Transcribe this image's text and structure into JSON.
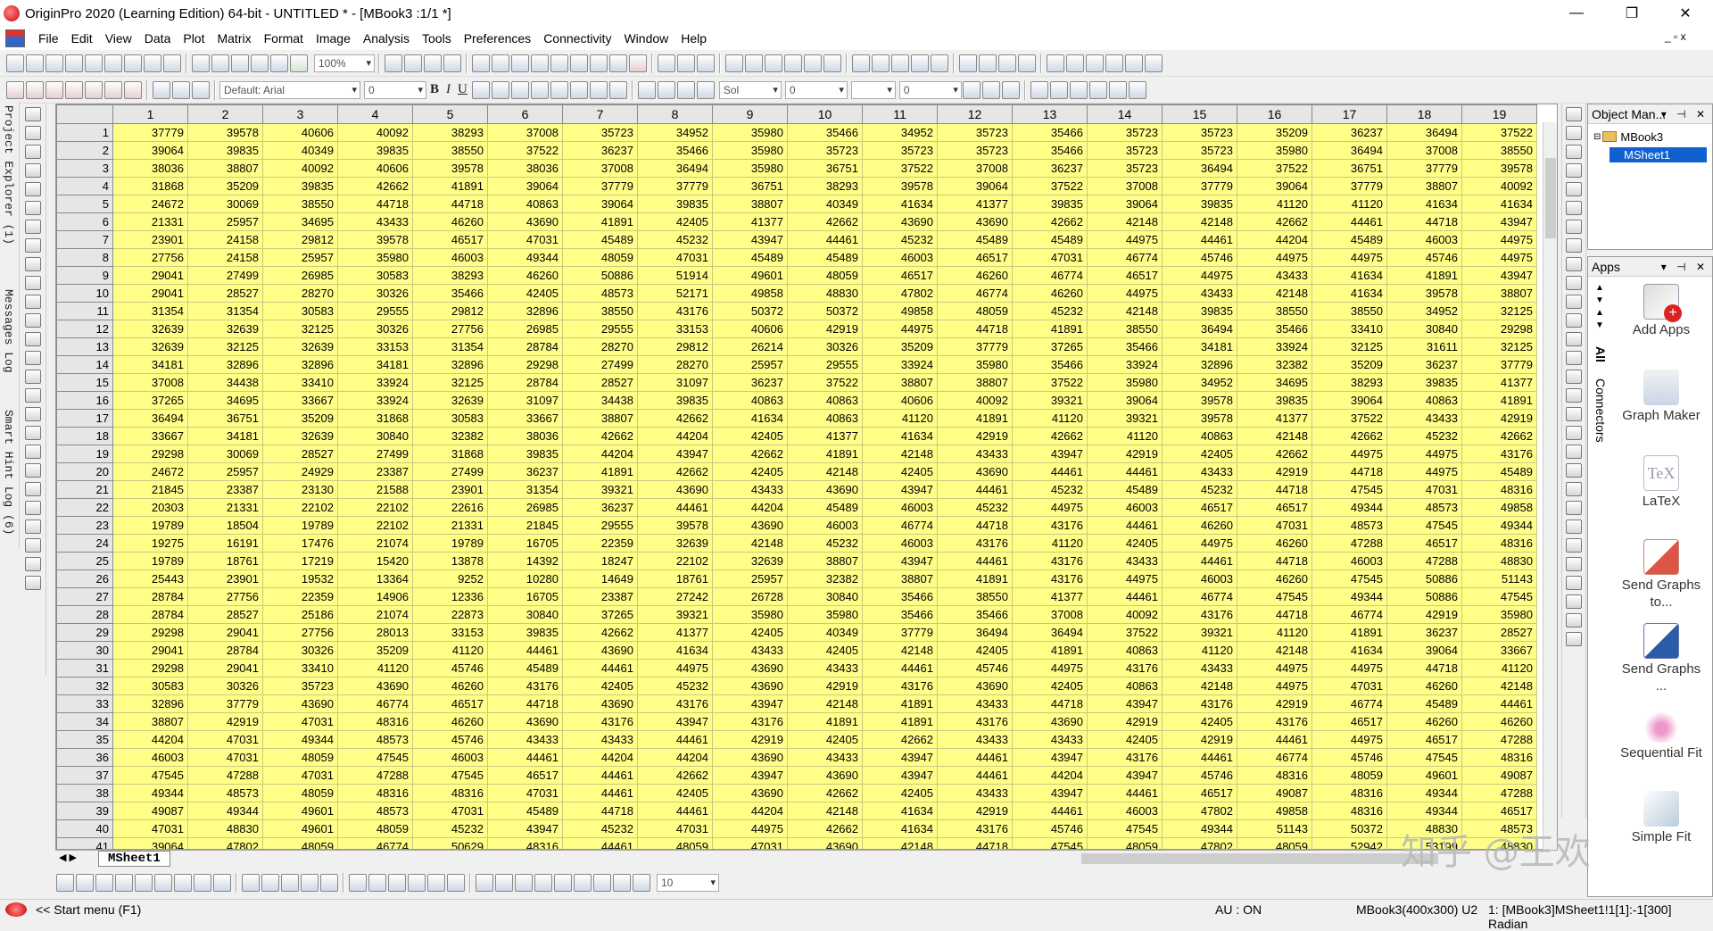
{
  "window": {
    "title": "OriginPro 2020 (Learning Edition) 64-bit - UNTITLED * - [MBook3 :1/1  *]",
    "minimize": "—",
    "maximize": "❐",
    "close": "✕",
    "mdi_controls": "_ ▫ x"
  },
  "menu": [
    "File",
    "Edit",
    "View",
    "Data",
    "Plot",
    "Matrix",
    "Format",
    "Image",
    "Analysis",
    "Tools",
    "Preferences",
    "Connectivity",
    "Window",
    "Help"
  ],
  "toolbar": {
    "zoom": "100%",
    "font": "Default: Arial",
    "font_size": "0",
    "line_style": "Sol",
    "line_width": "0",
    "size2": "0",
    "bottom_size": "10"
  },
  "left_tabs": {
    "project_explorer": "Project Explorer (1)",
    "messages_log": "Messages Log",
    "smart_hint_log": "Smart Hint Log (6)"
  },
  "sheet": {
    "tab_label": "MSheet1",
    "columns": [
      "1",
      "2",
      "3",
      "4",
      "5",
      "6",
      "7",
      "8",
      "9",
      "10",
      "11",
      "12",
      "13",
      "14",
      "15",
      "16",
      "17",
      "18",
      "19"
    ],
    "rows": [
      [
        "1",
        [
          "37779",
          "39578",
          "40606",
          "40092",
          "38293",
          "37008",
          "35723",
          "34952",
          "35980",
          "35466",
          "34952",
          "35723",
          "35466",
          "35723",
          "35723",
          "35209",
          "36237",
          "36494",
          "37522"
        ]
      ],
      [
        "2",
        [
          "39064",
          "39835",
          "40349",
          "39835",
          "38550",
          "37522",
          "36237",
          "35466",
          "35980",
          "35723",
          "35723",
          "35723",
          "35466",
          "35723",
          "35723",
          "35980",
          "36494",
          "37008",
          "38550"
        ]
      ],
      [
        "3",
        [
          "38036",
          "38807",
          "40092",
          "40606",
          "39578",
          "38036",
          "37008",
          "36494",
          "35980",
          "36751",
          "37522",
          "37008",
          "36237",
          "35723",
          "36494",
          "37522",
          "36751",
          "37779",
          "39578"
        ]
      ],
      [
        "4",
        [
          "31868",
          "35209",
          "39835",
          "42662",
          "41891",
          "39064",
          "37779",
          "37779",
          "36751",
          "38293",
          "39578",
          "39064",
          "37522",
          "37008",
          "37779",
          "39064",
          "37779",
          "38807",
          "40092"
        ]
      ],
      [
        "5",
        [
          "24672",
          "30069",
          "38550",
          "44718",
          "44718",
          "40863",
          "39064",
          "39835",
          "38807",
          "40349",
          "41634",
          "41377",
          "39835",
          "39064",
          "39835",
          "41120",
          "41120",
          "41634",
          "41634"
        ]
      ],
      [
        "6",
        [
          "21331",
          "25957",
          "34695",
          "43433",
          "46260",
          "43690",
          "41891",
          "42405",
          "41377",
          "42662",
          "43690",
          "43690",
          "42662",
          "42148",
          "42148",
          "42662",
          "44461",
          "44718",
          "43947"
        ]
      ],
      [
        "7",
        [
          "23901",
          "24158",
          "29812",
          "39578",
          "46517",
          "47031",
          "45489",
          "45232",
          "43947",
          "44461",
          "45232",
          "45489",
          "45489",
          "44975",
          "44461",
          "44204",
          "45489",
          "46003",
          "44975"
        ]
      ],
      [
        "8",
        [
          "27756",
          "24158",
          "25957",
          "35980",
          "46003",
          "49344",
          "48059",
          "47031",
          "45489",
          "45489",
          "46003",
          "46517",
          "47031",
          "46774",
          "45746",
          "44975",
          "44975",
          "45746",
          "44975"
        ]
      ],
      [
        "9",
        [
          "29041",
          "27499",
          "26985",
          "30583",
          "38293",
          "46260",
          "50886",
          "51914",
          "49601",
          "48059",
          "46517",
          "46260",
          "46774",
          "46517",
          "44975",
          "43433",
          "41634",
          "41891",
          "43947"
        ]
      ],
      [
        "10",
        [
          "29041",
          "28527",
          "28270",
          "30326",
          "35466",
          "42405",
          "48573",
          "52171",
          "49858",
          "48830",
          "47802",
          "46774",
          "46260",
          "44975",
          "43433",
          "42148",
          "41634",
          "39578",
          "38807"
        ]
      ],
      [
        "11",
        [
          "31354",
          "31354",
          "30583",
          "29555",
          "29812",
          "32896",
          "38550",
          "43176",
          "50372",
          "50372",
          "49858",
          "48059",
          "45232",
          "42148",
          "39835",
          "38550",
          "38550",
          "34952",
          "32125"
        ]
      ],
      [
        "12",
        [
          "32639",
          "32639",
          "32125",
          "30326",
          "27756",
          "26985",
          "29555",
          "33153",
          "40606",
          "42919",
          "44975",
          "44718",
          "41891",
          "38550",
          "36494",
          "35466",
          "33410",
          "30840",
          "29298"
        ]
      ],
      [
        "13",
        [
          "32639",
          "32125",
          "32639",
          "33153",
          "31354",
          "28784",
          "28270",
          "29812",
          "26214",
          "30326",
          "35209",
          "37779",
          "37265",
          "35466",
          "34181",
          "33924",
          "32125",
          "31611",
          "32125"
        ]
      ],
      [
        "14",
        [
          "34181",
          "32896",
          "32896",
          "34181",
          "32896",
          "29298",
          "27499",
          "28270",
          "25957",
          "29555",
          "33924",
          "35980",
          "35466",
          "33924",
          "32896",
          "32382",
          "35209",
          "36237",
          "37779"
        ]
      ],
      [
        "15",
        [
          "37008",
          "34438",
          "33410",
          "33924",
          "32125",
          "28784",
          "28527",
          "31097",
          "36237",
          "37522",
          "38807",
          "38807",
          "37522",
          "35980",
          "34952",
          "34695",
          "38293",
          "39835",
          "41377"
        ]
      ],
      [
        "16",
        [
          "37265",
          "34695",
          "33667",
          "33924",
          "32639",
          "31097",
          "34438",
          "39835",
          "40863",
          "40863",
          "40606",
          "40092",
          "39321",
          "39064",
          "39578",
          "39835",
          "39064",
          "40863",
          "41891"
        ]
      ],
      [
        "17",
        [
          "36494",
          "36751",
          "35209",
          "31868",
          "30583",
          "33667",
          "38807",
          "42662",
          "41634",
          "40863",
          "41120",
          "41891",
          "41120",
          "39321",
          "39578",
          "41377",
          "37522",
          "43433",
          "42919"
        ]
      ],
      [
        "18",
        [
          "33667",
          "34181",
          "32639",
          "30840",
          "32382",
          "38036",
          "42662",
          "44204",
          "42405",
          "41377",
          "41634",
          "42919",
          "42662",
          "41120",
          "40863",
          "42148",
          "42662",
          "45232",
          "42662"
        ]
      ],
      [
        "19",
        [
          "29298",
          "30069",
          "28527",
          "27499",
          "31868",
          "39835",
          "44204",
          "43947",
          "42662",
          "41891",
          "42148",
          "43433",
          "43947",
          "42919",
          "42405",
          "42662",
          "44975",
          "44975",
          "43176"
        ]
      ],
      [
        "20",
        [
          "24672",
          "25957",
          "24929",
          "23387",
          "27499",
          "36237",
          "41891",
          "42662",
          "42405",
          "42148",
          "42405",
          "43690",
          "44461",
          "44461",
          "43433",
          "42919",
          "44718",
          "44975",
          "45489"
        ]
      ],
      [
        "21",
        [
          "21845",
          "23387",
          "23130",
          "21588",
          "23901",
          "31354",
          "39321",
          "43690",
          "43433",
          "43690",
          "43947",
          "44461",
          "45232",
          "45489",
          "45232",
          "44718",
          "47545",
          "47031",
          "48316"
        ]
      ],
      [
        "22",
        [
          "20303",
          "21331",
          "22102",
          "22102",
          "22616",
          "26985",
          "36237",
          "44461",
          "44204",
          "45489",
          "46003",
          "45232",
          "44975",
          "46003",
          "46517",
          "46517",
          "49344",
          "48573",
          "49858"
        ]
      ],
      [
        "23",
        [
          "19789",
          "18504",
          "19789",
          "22102",
          "21331",
          "21845",
          "29555",
          "39578",
          "43690",
          "46003",
          "46774",
          "44718",
          "43176",
          "44461",
          "46260",
          "47031",
          "48573",
          "47545",
          "49344"
        ]
      ],
      [
        "24",
        [
          "19275",
          "16191",
          "17476",
          "21074",
          "19789",
          "16705",
          "22359",
          "32639",
          "42148",
          "45232",
          "46003",
          "43176",
          "41120",
          "42405",
          "44975",
          "46260",
          "47288",
          "46517",
          "48316"
        ]
      ],
      [
        "25",
        [
          "19789",
          "18761",
          "17219",
          "15420",
          "13878",
          "14392",
          "18247",
          "22102",
          "32639",
          "38807",
          "43947",
          "44461",
          "43176",
          "43433",
          "44461",
          "44718",
          "46003",
          "47288",
          "48830"
        ]
      ],
      [
        "26",
        [
          "25443",
          "23901",
          "19532",
          "13364",
          "9252",
          "10280",
          "14649",
          "18761",
          "25957",
          "32382",
          "38807",
          "41891",
          "43176",
          "44975",
          "46003",
          "46260",
          "47545",
          "50886",
          "51143"
        ]
      ],
      [
        "27",
        [
          "28784",
          "27756",
          "22359",
          "14906",
          "12336",
          "16705",
          "23387",
          "27242",
          "26728",
          "30840",
          "35466",
          "38550",
          "41377",
          "44461",
          "46774",
          "47545",
          "49344",
          "50886",
          "47545"
        ]
      ],
      [
        "28",
        [
          "28784",
          "28527",
          "25186",
          "21074",
          "22873",
          "30840",
          "37265",
          "39321",
          "35980",
          "35980",
          "35466",
          "35466",
          "37008",
          "40092",
          "43176",
          "44718",
          "46774",
          "42919",
          "35980"
        ]
      ],
      [
        "29",
        [
          "29298",
          "29041",
          "27756",
          "28013",
          "33153",
          "39835",
          "42662",
          "41377",
          "42405",
          "40349",
          "37779",
          "36494",
          "36494",
          "37522",
          "39321",
          "41120",
          "41891",
          "36237",
          "28527"
        ]
      ],
      [
        "30",
        [
          "29041",
          "28784",
          "30326",
          "35209",
          "41120",
          "44461",
          "43690",
          "41634",
          "43433",
          "42405",
          "42148",
          "42405",
          "41891",
          "40863",
          "41120",
          "42148",
          "41634",
          "39064",
          "33667"
        ]
      ],
      [
        "31",
        [
          "29298",
          "29041",
          "33410",
          "41120",
          "45746",
          "45489",
          "44461",
          "44975",
          "43690",
          "43433",
          "44461",
          "45746",
          "44975",
          "43176",
          "43433",
          "44975",
          "44975",
          "44718",
          "41120"
        ]
      ],
      [
        "32",
        [
          "30583",
          "30326",
          "35723",
          "43690",
          "46260",
          "43176",
          "42405",
          "45232",
          "43690",
          "42919",
          "43176",
          "43690",
          "42405",
          "40863",
          "42148",
          "44975",
          "47031",
          "46260",
          "42148"
        ]
      ],
      [
        "33",
        [
          "32896",
          "37779",
          "43690",
          "46774",
          "46517",
          "44718",
          "43690",
          "43176",
          "43947",
          "42148",
          "41891",
          "43433",
          "44718",
          "43947",
          "43176",
          "42919",
          "46774",
          "45489",
          "44461"
        ]
      ],
      [
        "34",
        [
          "38807",
          "42919",
          "47031",
          "48316",
          "46260",
          "43690",
          "43176",
          "43947",
          "43176",
          "41891",
          "41891",
          "43176",
          "43690",
          "42919",
          "42405",
          "43176",
          "46517",
          "46260",
          "46260"
        ]
      ],
      [
        "35",
        [
          "44204",
          "47031",
          "49344",
          "48573",
          "45746",
          "43433",
          "43433",
          "44461",
          "42919",
          "42405",
          "42662",
          "43433",
          "43433",
          "42405",
          "42919",
          "44461",
          "44975",
          "46517",
          "47288"
        ]
      ],
      [
        "36",
        [
          "46003",
          "47031",
          "48059",
          "47545",
          "46003",
          "44461",
          "44204",
          "44204",
          "43690",
          "43433",
          "43947",
          "44461",
          "43947",
          "43176",
          "44461",
          "46774",
          "45746",
          "47545",
          "48316"
        ]
      ],
      [
        "37",
        [
          "47545",
          "47288",
          "47031",
          "47288",
          "47545",
          "46517",
          "44461",
          "42662",
          "43947",
          "43690",
          "43947",
          "44461",
          "44204",
          "43947",
          "45746",
          "48316",
          "48059",
          "49601",
          "49087"
        ]
      ],
      [
        "38",
        [
          "49344",
          "48573",
          "48059",
          "48316",
          "48316",
          "47031",
          "44461",
          "42405",
          "43690",
          "42662",
          "42405",
          "43433",
          "43947",
          "44461",
          "46517",
          "49087",
          "48316",
          "49344",
          "47288"
        ]
      ],
      [
        "39",
        [
          "49087",
          "49344",
          "49601",
          "48573",
          "47031",
          "45489",
          "44718",
          "44461",
          "44204",
          "42148",
          "41634",
          "42919",
          "44461",
          "46003",
          "47802",
          "49858",
          "48316",
          "49344",
          "46517"
        ]
      ],
      [
        "40",
        [
          "47031",
          "48830",
          "49601",
          "48059",
          "45232",
          "43947",
          "45232",
          "47031",
          "44975",
          "42662",
          "41634",
          "43176",
          "45746",
          "47545",
          "49344",
          "51143",
          "50372",
          "48830",
          "48573"
        ]
      ],
      [
        "41",
        [
          "39064",
          "47802",
          "48059",
          "46774",
          "50629",
          "48316",
          "44461",
          "48059",
          "47031",
          "43690",
          "42148",
          "44718",
          "47545",
          "48059",
          "47802",
          "48059",
          "52942",
          "53199",
          "48830"
        ]
      ]
    ]
  },
  "object_manager": {
    "title": "Object Man...",
    "book": "MBook3",
    "sheet": "MSheet1"
  },
  "apps_panel": {
    "title": "Apps",
    "tab_all": "All",
    "tab_connectors": "Connectors",
    "items": [
      {
        "label": "Add Apps"
      },
      {
        "label": "Graph Maker"
      },
      {
        "label": "LaTeX"
      },
      {
        "label": "Send Graphs to..."
      },
      {
        "label": "Send Graphs ..."
      },
      {
        "label": "Sequential Fit"
      },
      {
        "label": "Simple Fit"
      }
    ]
  },
  "status": {
    "start_menu": "<< Start menu (F1)",
    "au": "AU : ON",
    "book_info": "MBook3(400x300) U2",
    "cell_info": "1: [MBook3]MSheet1!1[1]:-1[300] Radian"
  },
  "watermark": "知乎 @王欢",
  "colors": {
    "cell_bg": "#ffff88",
    "header_bg": "#e6e6e6",
    "selection": "#1060d0"
  }
}
